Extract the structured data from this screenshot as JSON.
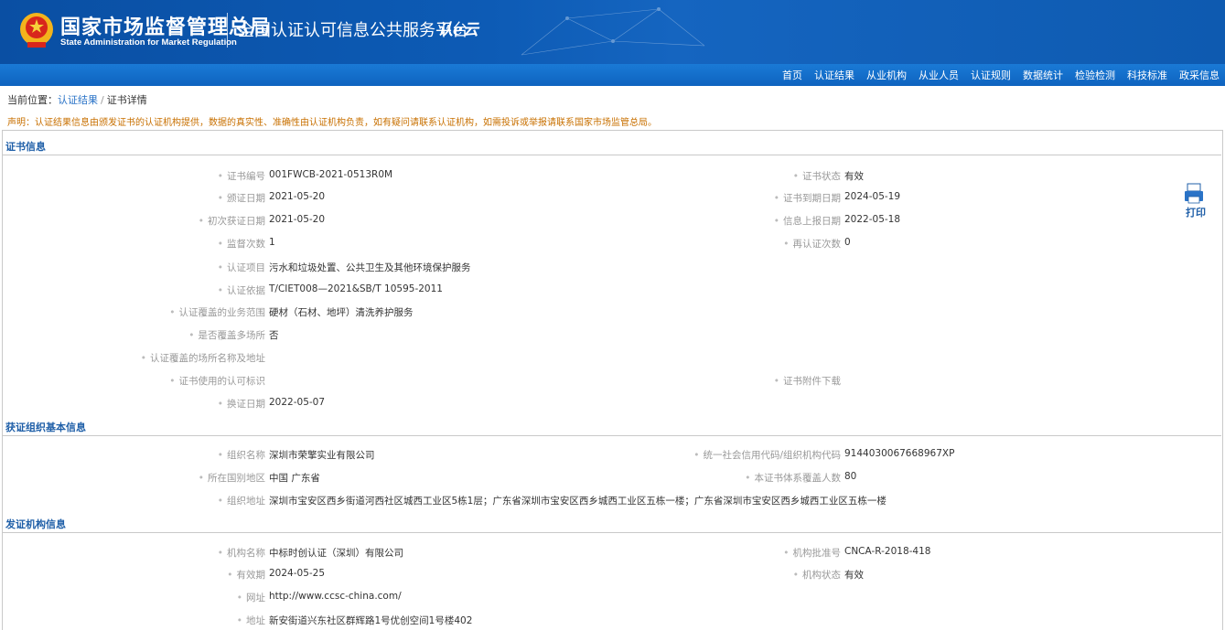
{
  "header": {
    "brand_cn": "国家市场监督管理总局",
    "brand_en": "State Administration for Market Regulation",
    "platform": "全国认证认可信息公共服务平台",
    "platform_logo": "认e云"
  },
  "nav": [
    "首页",
    "认证结果",
    "从业机构",
    "从业人员",
    "认证规则",
    "数据统计",
    "检验检测",
    "科技标准",
    "政采信息"
  ],
  "breadcrumb": {
    "prefix": "当前位置：",
    "link": "认证结果",
    "separator": "/",
    "current": "证书详情"
  },
  "notice": "声明：认证结果信息由颁发证书的认证机构提供，数据的真实性、准确性由认证机构负责，如有疑问请联系认证机构，如需投诉或举报请联系国家市场监管总局。",
  "print_label": "打印",
  "cert": {
    "title": "证书信息",
    "no_label": "证书编号",
    "no": "001FWCB-2021-0513R0M",
    "status_label": "证书状态",
    "status": "有效",
    "issue_label": "颁证日期",
    "issue": "2021-05-20",
    "expire_label": "证书到期日期",
    "expire": "2024-05-19",
    "first_label": "初次获证日期",
    "first": "2021-05-20",
    "report_label": "信息上报日期",
    "report": "2022-05-18",
    "supervise_label": "监督次数",
    "supervise": "1",
    "recert_label": "再认证次数",
    "recert": "0",
    "project_label": "认证项目",
    "project": "污水和垃圾处置、公共卫生及其他环境保护服务",
    "basis_label": "认证依据",
    "basis": "T/CIET008—2021&SB/T 10595-2011",
    "scope_label": "认证覆盖的业务范围",
    "scope": "硬材（石材、地坪）清洗养护服务",
    "multisite_label": "是否覆盖多场所",
    "multisite": "否",
    "sites_label": "认证覆盖的场所名称及地址",
    "sites": "",
    "mark_label": "证书使用的认可标识",
    "mark": "",
    "attach_label": "证书附件下载",
    "attach": "",
    "change_label": "换证日期",
    "change": "2022-05-07"
  },
  "org": {
    "title": "获证组织基本信息",
    "name_label": "组织名称",
    "name": "深圳市荣擎实业有限公司",
    "credit_label": "统一社会信用代码/组织机构代码",
    "credit": "914403006766896​7XP",
    "region_label": "所在国别地区",
    "region": "中国 广东省",
    "headcount_label": "本证书体系覆盖人数",
    "headcount": "80",
    "address_label": "组织地址",
    "address": "深圳市宝安区西乡街道河西社区城西工业区5栋1层；广东省深圳市宝安区西乡城西工业区五栋一楼；广东省深圳市宝安区西乡城西工业区五栋一楼"
  },
  "agency": {
    "title": "发证机构信息",
    "name_label": "机构名称",
    "name": "中标时创认证（深圳）有限公司",
    "approval_label": "机构批准号",
    "approval": "CNCA-R-2018-418",
    "valid_label": "有效期",
    "valid": "2024-05-25",
    "status_label": "机构状态",
    "status": "有效",
    "url_label": "网址",
    "url": "http://www.ccsc-china.com/",
    "address_label": "地址",
    "address": "新安街道兴东社区群辉路1号优创空间1号楼402"
  }
}
